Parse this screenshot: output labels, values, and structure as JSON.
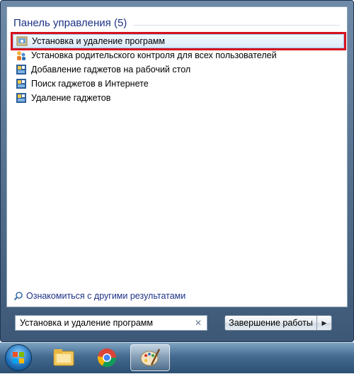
{
  "section": {
    "title": "Панель управления (5)"
  },
  "results": [
    {
      "label": "Установка и удаление программ",
      "icon": "programs-features-icon"
    },
    {
      "label": "Установка родительского контроля для всех пользователей",
      "icon": "parental-controls-icon"
    },
    {
      "label": "Добавление гаджетов на рабочий стол",
      "icon": "gadgets-icon"
    },
    {
      "label": "Поиск гаджетов в Интернете",
      "icon": "gadgets-icon"
    },
    {
      "label": "Удаление гаджетов",
      "icon": "gadgets-icon"
    }
  ],
  "more_results": {
    "label": "Ознакомиться с другими результатами",
    "icon": "search-icon"
  },
  "search": {
    "value": "Установка и удаление программ",
    "clear_glyph": "✕"
  },
  "shutdown": {
    "label": "Завершение работы",
    "arrow_glyph": "▶"
  },
  "taskbar": {
    "items": [
      {
        "name": "start-button",
        "icon": "windows-logo-icon"
      },
      {
        "name": "file-explorer",
        "icon": "folder-icon"
      },
      {
        "name": "chrome",
        "icon": "chrome-icon"
      },
      {
        "name": "paint",
        "icon": "palette-icon",
        "active": true
      }
    ]
  },
  "colors": {
    "highlight": "#d6111d",
    "heading": "#1e3287"
  }
}
